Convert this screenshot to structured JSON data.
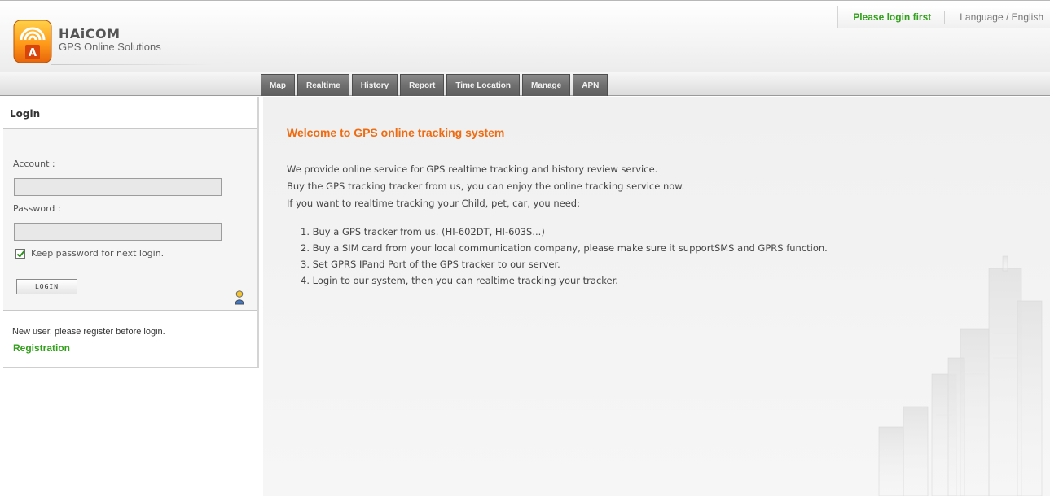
{
  "header": {
    "brand_name": "HAiCOM",
    "brand_tagline": "GPS Online Solutions",
    "login_status": "Please login first",
    "language": "Language / English"
  },
  "nav": {
    "tabs": [
      {
        "label": "Map"
      },
      {
        "label": "Realtime"
      },
      {
        "label": "History"
      },
      {
        "label": "Report"
      },
      {
        "label": "Time Location"
      },
      {
        "label": "Manage"
      },
      {
        "label": "APN"
      }
    ]
  },
  "login": {
    "title": "Login",
    "account_label": "Account :",
    "account_value": "",
    "password_label": "Password :",
    "password_value": "",
    "keep_password": "Keep password for next login.",
    "keep_checked": true,
    "button": "LOGIN",
    "new_user_text": "New user, please register before login.",
    "registration_link": "Registration"
  },
  "content": {
    "welcome_title": "Welcome to GPS online tracking system",
    "paragraphs": [
      "We provide online service for GPS realtime tracking and history review service.",
      "Buy the GPS tracking tracker from us, you can enjoy the online tracking service now.",
      "If you want to realtime tracking your Child, pet, car, you need:"
    ],
    "steps": [
      "1.  Buy a GPS tracker from us. (HI-602DT, HI-603S...)",
      "2.  Buy a SIM card from your local communication company, please make sure it supportSMS and GPRS function.",
      "3.  Set GPRS IPand Port of the GPS tracker to our server.",
      "4.  Login to our system, then you can realtime tracking your tracker."
    ]
  },
  "colors": {
    "accent_orange": "#f06a0f",
    "link_green": "#33a01c",
    "tab_gray": "#6f6f6f"
  },
  "icons": {
    "logo": "gps-signal-logo-icon",
    "user": "user-icon",
    "check": "checkbox-checked-icon"
  }
}
